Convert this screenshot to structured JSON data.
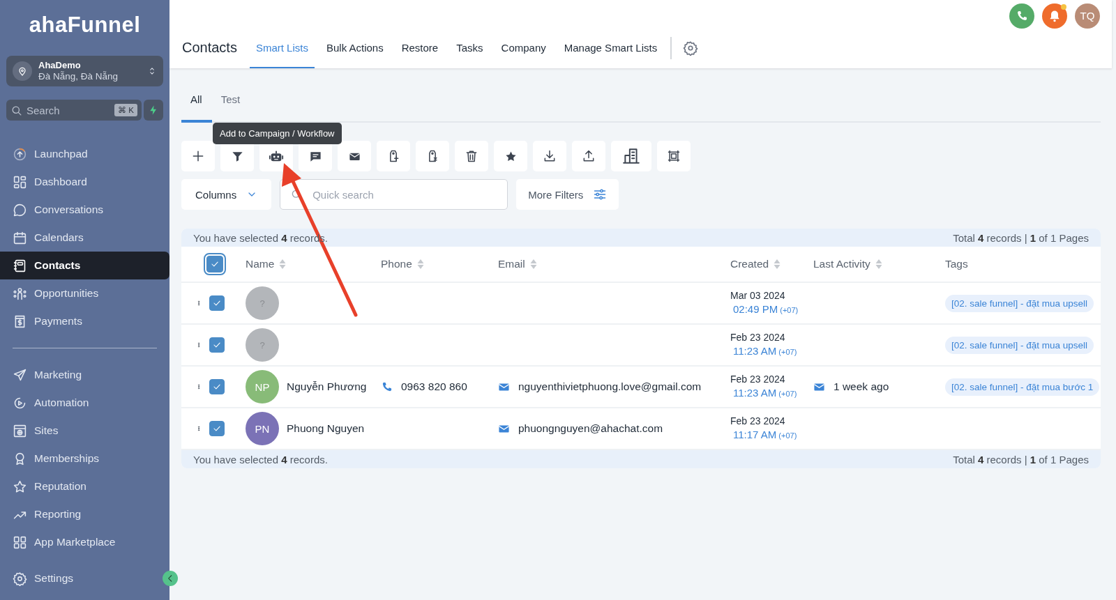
{
  "sidebar": {
    "logo": "ahaFunnel",
    "location": {
      "name": "AhaDemo",
      "address": "Đà Nẵng, Đà Nẵng"
    },
    "search": {
      "placeholder": "Search",
      "shortcut": "⌘ K"
    },
    "groups": [
      {
        "items": [
          {
            "label": "Launchpad",
            "selected": false
          },
          {
            "label": "Dashboard",
            "selected": false
          },
          {
            "label": "Conversations",
            "selected": false
          },
          {
            "label": "Calendars",
            "selected": false
          },
          {
            "label": "Contacts",
            "selected": true
          },
          {
            "label": "Opportunities",
            "selected": false
          },
          {
            "label": "Payments",
            "selected": false
          }
        ]
      },
      {
        "items": [
          {
            "label": "Marketing",
            "selected": false
          },
          {
            "label": "Automation",
            "selected": false
          },
          {
            "label": "Sites",
            "selected": false
          },
          {
            "label": "Memberships",
            "selected": false
          },
          {
            "label": "Reputation",
            "selected": false
          },
          {
            "label": "Reporting",
            "selected": false
          },
          {
            "label": "App Marketplace",
            "selected": false
          }
        ]
      }
    ],
    "footer_item": {
      "label": "Settings",
      "selected": false
    }
  },
  "header": {
    "title": "Contacts",
    "tabs": [
      {
        "label": "Smart Lists",
        "selected": true
      },
      {
        "label": "Bulk Actions",
        "selected": false
      },
      {
        "label": "Restore",
        "selected": false
      },
      {
        "label": "Tasks",
        "selected": false
      },
      {
        "label": "Company",
        "selected": false
      },
      {
        "label": "Manage Smart Lists",
        "selected": false
      }
    ],
    "notifications": {
      "unread": true
    },
    "avatar": {
      "initials": "TQ"
    }
  },
  "subtabs": [
    {
      "label": "All",
      "selected": true
    },
    {
      "label": "Test",
      "selected": false
    }
  ],
  "toolbar": {
    "tooltip": "Add to Campaign / Workflow"
  },
  "filters": {
    "columns_button": "Columns",
    "search": {
      "placeholder": "Quick search"
    },
    "more_filters": "More Filters"
  },
  "table": {
    "top_bar": {
      "selection_text": "You have selected **4** records.",
      "total_text": "Total **4** records | **1** of 1 Pages"
    },
    "all_checked": true,
    "columns": [
      {
        "label": "Name",
        "sortable": true
      },
      {
        "label": "Phone",
        "sortable": true
      },
      {
        "label": "Email",
        "sortable": true
      },
      {
        "label": "Created",
        "sortable": true
      },
      {
        "label": "Last Activity",
        "sortable": true
      },
      {
        "label": "Tags",
        "sortable": false
      }
    ],
    "rows": [
      {
        "checked": true,
        "avatar": {
          "initials": "?",
          "color": "#b3b6ba"
        },
        "created_date": "Mar 03 2024",
        "created_time": "02:49 PM",
        "timezone": "(+07)",
        "tag": "[02. sale funnel] - đặt mua upsell"
      },
      {
        "checked": true,
        "avatar": {
          "initials": "?",
          "color": "#b3b6ba"
        },
        "created_date": "Feb 23 2024",
        "created_time": "11:23 AM",
        "timezone": "(+07)",
        "tag": "[02. sale funnel] - đặt mua upsell"
      },
      {
        "checked": true,
        "avatar": {
          "initials": "NP",
          "color": "#88bb78"
        },
        "name": "Nguyễn Phương",
        "phone": "0963 820 860",
        "email": "nguyenthivietphuong.love@gmail.com",
        "created_date": "Feb 23 2024",
        "created_time": "11:23 AM",
        "timezone": "(+07)",
        "last_activity": "1 week ago",
        "tag": "[02. sale funnel] - đặt mua bước 1"
      },
      {
        "checked": true,
        "avatar": {
          "initials": "PN",
          "color": "#7b72b6"
        },
        "name": "Phuong Nguyen",
        "email": "phuongnguyen@ahachat.com",
        "created_date": "Feb 23 2024",
        "created_time": "11:17 AM",
        "timezone": "(+07)"
      }
    ],
    "bottom_bar": {
      "selection_text": "You have selected **4** records.",
      "total_text": "Total **4** records | **1** of 1 Pages"
    }
  }
}
